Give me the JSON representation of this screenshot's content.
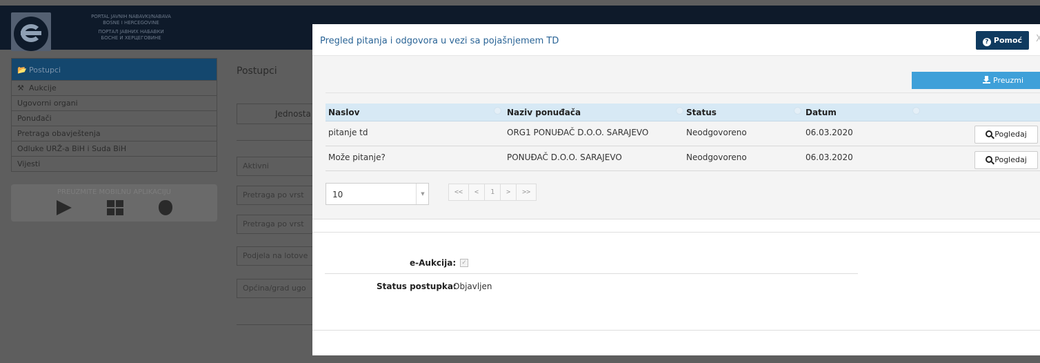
{
  "header": {
    "portal_lines": [
      "PORTAL JAVNIH NABAVKI/NABAVA",
      "BOSNE I HERCEGOVINE",
      "ПОРТАЛ ЈАВНИХ НАБАВКИ",
      "БОСНЕ И ХЕРЦЕГОВИНЕ"
    ]
  },
  "sidebar": {
    "items": [
      {
        "label": "Postupci",
        "icon": "folder-open-icon",
        "active": true
      },
      {
        "label": "Aukcije",
        "icon": "gavel-icon"
      },
      {
        "label": "Ugovorni organi"
      },
      {
        "label": "Ponuđači"
      },
      {
        "label": "Pretraga obavještenja"
      },
      {
        "label": "Odluke URŽ-a BiH i Suda BiH"
      },
      {
        "label": "Vijesti"
      }
    ],
    "mobile_label": "PREUZMITE MOBILNU APLIKACIJU"
  },
  "main": {
    "title": "Postupci",
    "tab_label": "Jednosta",
    "fields": [
      "Aktivni",
      "Pretraga po vrst",
      "Pretraga po vrst",
      "Podjela na lotove",
      "Općina/grad ugo"
    ]
  },
  "modal": {
    "title": "Pregled pitanja i odgovora u vezi sa pojašnjemem TD",
    "help_label": "Pomoć",
    "close_label": "X",
    "download_label": "Preuzmi",
    "columns": [
      "Naslov",
      "Naziv ponuđača",
      "Status",
      "Datum"
    ],
    "rows": [
      {
        "naslov": "pitanje td",
        "ponudjac": "ORG1 PONUĐAČ D.O.O. SARAJEVO",
        "status": "Neodgovoreno",
        "datum": "06.03.2020",
        "action": "Pogledaj"
      },
      {
        "naslov": "Može pitanje?",
        "ponudjac": "PONUĐAČ D.O.O. SARAJEVO",
        "status": "Neodgovoreno",
        "datum": "06.03.2020",
        "action": "Pogledaj"
      }
    ],
    "page_size": "10",
    "pager": [
      "<<",
      "<",
      "1",
      ">",
      ">>"
    ]
  },
  "details": {
    "eauction_label": "e-Aukcija:",
    "eauction_checked": true,
    "status_label": "Status postupka:",
    "status_value": "Objavljen"
  }
}
